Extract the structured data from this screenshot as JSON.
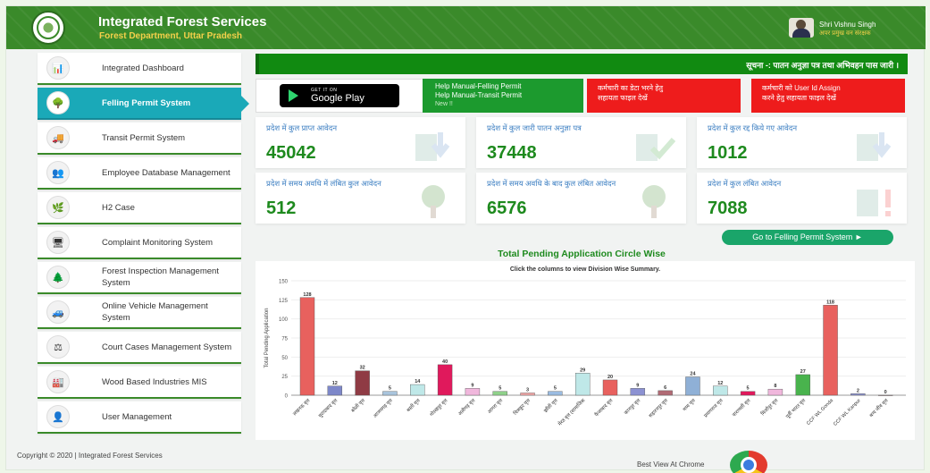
{
  "header": {
    "title": "Integrated Forest Services",
    "subtitle": "Forest Department, Uttar Pradesh",
    "user_name": "Shri Vishnu Singh",
    "user_role": "अपर प्रमुख वन संरक्षक"
  },
  "sidebar": {
    "items": [
      {
        "label": "Integrated Dashboard",
        "icon": "chart-icon",
        "active": false
      },
      {
        "label": "Felling Permit System",
        "icon": "tree-icon",
        "active": true
      },
      {
        "label": "Transit Permit System",
        "icon": "truck-icon",
        "active": false
      },
      {
        "label": "Employee Database Management",
        "icon": "people-icon",
        "active": false
      },
      {
        "label": "H2 Case",
        "icon": "h2-case-icon",
        "active": false
      },
      {
        "label": "Complaint Monitoring System",
        "icon": "monitor-icon",
        "active": false
      },
      {
        "label": "Forest Inspection Management System",
        "icon": "inspection-icon",
        "active": false
      },
      {
        "label": "Online Vehicle Management System",
        "icon": "vehicle-icon",
        "active": false
      },
      {
        "label": "Court Cases Management System",
        "icon": "court-icon",
        "active": false
      },
      {
        "label": "Wood Based Industries MIS",
        "icon": "factory-icon",
        "active": false
      },
      {
        "label": "User Management",
        "icon": "users-icon",
        "active": false
      }
    ]
  },
  "notice": "सूचना -: पातन अनुज्ञा पत्र तथा अभिवहन पास जारी ।",
  "google_play": {
    "small": "GET IT ON",
    "big": "Google Play"
  },
  "help": {
    "line1": "Help Manual-Felling Permit",
    "line2": "Help Manual-Transit Permit",
    "new": "New !!"
  },
  "red_buttons": [
    {
      "line1": "कर्मचारी का डेटा भरने हेतु",
      "line2": "सहायता फाइल देखें"
    },
    {
      "line1": "कर्मचारी को User Id Assign",
      "line2": "करने हेतु सहायता फाइल देखें"
    }
  ],
  "stats": [
    {
      "label": "प्रदेश में कुल प्राप्त आवेदन",
      "value": "45042"
    },
    {
      "label": "प्रदेश में कुल जारी पातन अनुज्ञा पत्र",
      "value": "37448"
    },
    {
      "label": "प्रदेश में कुल रद्द किये गए आवेदन",
      "value": "1012"
    },
    {
      "label": "प्रदेश में समय अवधि में लंबित कुल आवेदन",
      "value": "512"
    },
    {
      "label": "प्रदेश में समय अवधि के बाद कुल लंबित आवेदन",
      "value": "6576"
    },
    {
      "label": "प्रदेश में कुल लंबित आवेदन",
      "value": "7088"
    }
  ],
  "goto_button": "Go to Felling Permit System ►",
  "chart_data": {
    "type": "bar",
    "title": "Total Pending Application Circle Wise",
    "subtitle": "Click the columns to view Division Wise Summary.",
    "ylabel": "Total Pending Application",
    "ylim": [
      0,
      150
    ],
    "yticks": [
      0,
      25,
      50,
      75,
      100,
      125,
      150
    ],
    "categories": [
      "लखनऊ वृत्त",
      "मुरादाबाद वृत्त",
      "बरेली वृत्त",
      "आजमगढ़ वृत्त",
      "बस्ती वृत्त",
      "गोरखपुर वृत्त",
      "अलीगढ़ वृत्त",
      "आगरा वृत्त",
      "चित्रकूट वृत्त",
      "झाँसी वृत्त",
      "मेरठ वृत्त (सामाजिक",
      "फैजाबाद वृत्त",
      "कानपुर वृत्त",
      "सहारनपुर वृत्त",
      "मध्य वृत्त",
      "प्रयागराज वृत्त",
      "वाराणसी वृत्त",
      "मिर्जापुर वृत्त",
      "पूर्वी भारत वृत्त",
      "CCF WL Gonda",
      "CCF WL Kanpur",
      "बन्य जीव वृत्त"
    ],
    "values": [
      128,
      12,
      32,
      5,
      14,
      40,
      9,
      5,
      3,
      5,
      29,
      20,
      9,
      6,
      24,
      12,
      5,
      8,
      27,
      118,
      2,
      0
    ],
    "colors": [
      "#e8615e",
      "#7d87c9",
      "#8f3b44",
      "#a9c4dc",
      "#bfe8e8",
      "#e0195c",
      "#f0b7dc",
      "#8fd08a",
      "#f2a7a7",
      "#9bbce1",
      "#bfe8e8",
      "#e8615e",
      "#8c92d2",
      "#b06a74",
      "#8fb0d6",
      "#bfe8e8",
      "#e0195c",
      "#f0b7dc",
      "#49b34d",
      "#e8615e",
      "#8c92d2",
      "#8f3b44"
    ]
  },
  "footer": {
    "copyright": "Copyright © 2020 | Integrated Forest Services",
    "best_view": "Best View At Chrome"
  }
}
